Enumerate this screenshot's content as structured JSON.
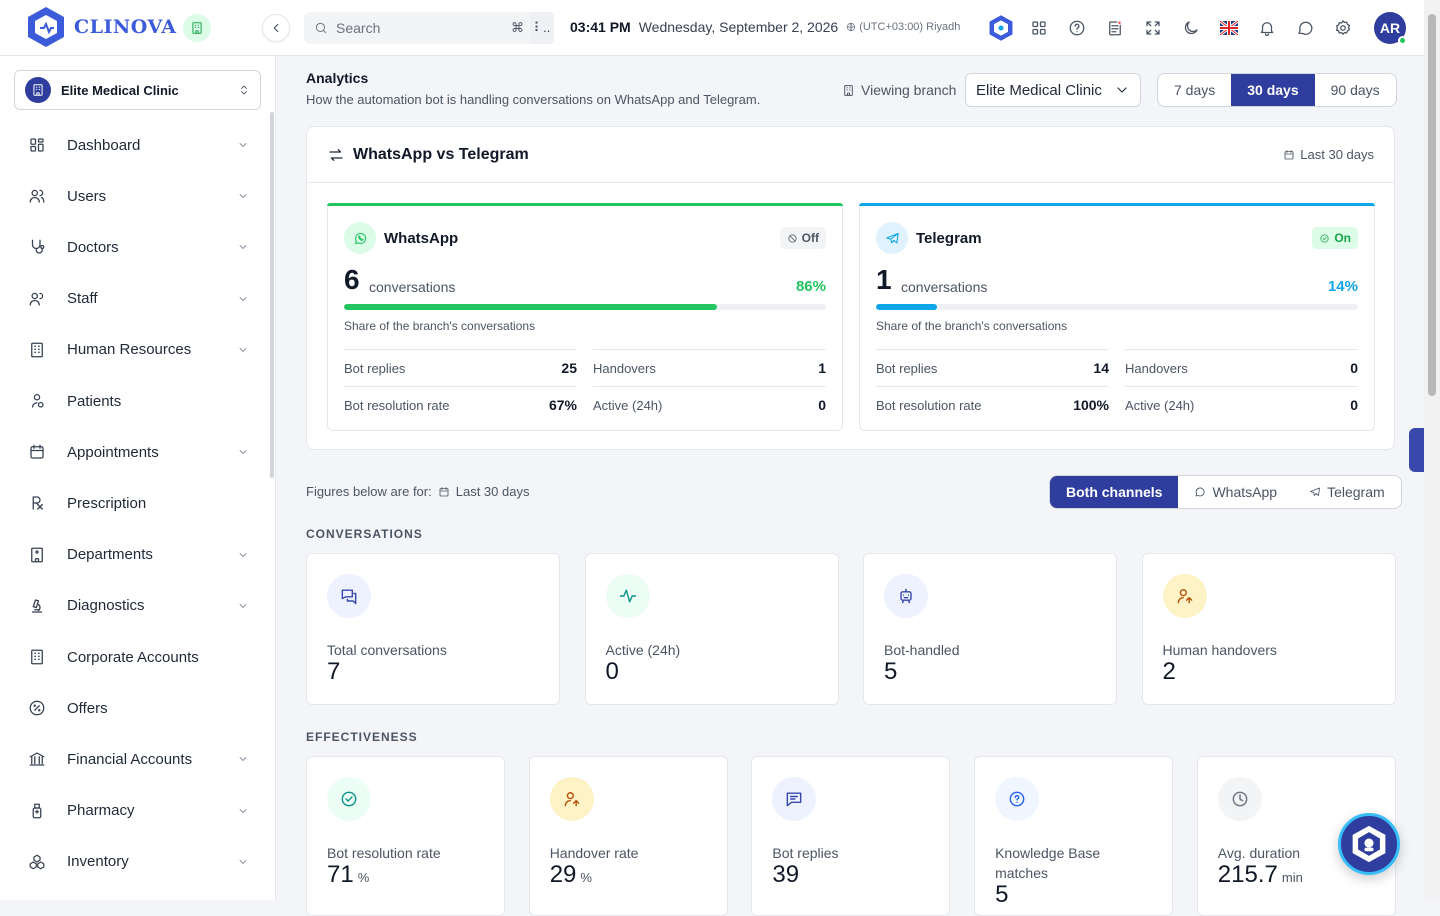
{
  "app": {
    "name": "CLINOVA"
  },
  "header": {
    "search_placeholder": "Search",
    "search_shortcut": "⌘",
    "search_more": "⠇..",
    "time": "03:41 PM",
    "date": "Wednesday, September 2, 2026",
    "timezone": "(UTC+03:00) Riyadh",
    "avatar_initials": "AR",
    "icons": [
      "apps-icon",
      "help-icon",
      "notes-icon",
      "fullscreen-icon",
      "dark-mode-icon",
      "language-flag-icon",
      "bell-icon",
      "chat-icon",
      "settings-icon"
    ]
  },
  "sidebar": {
    "branch": "Elite Medical Clinic",
    "items": [
      {
        "label": "Dashboard",
        "icon": "dashboard-icon",
        "chevron": true
      },
      {
        "label": "Users",
        "icon": "users-icon",
        "chevron": true
      },
      {
        "label": "Doctors",
        "icon": "stethoscope-icon",
        "chevron": true
      },
      {
        "label": "Staff",
        "icon": "staff-icon",
        "chevron": true
      },
      {
        "label": "Human Resources",
        "icon": "building-icon",
        "chevron": true
      },
      {
        "label": "Patients",
        "icon": "patient-icon",
        "chevron": false
      },
      {
        "label": "Appointments",
        "icon": "calendar-icon",
        "chevron": true
      },
      {
        "label": "Prescription",
        "icon": "prescription-icon",
        "chevron": false
      },
      {
        "label": "Departments",
        "icon": "hospital-icon",
        "chevron": true
      },
      {
        "label": "Diagnostics",
        "icon": "microscope-icon",
        "chevron": true
      },
      {
        "label": "Corporate Accounts",
        "icon": "office-icon",
        "chevron": false
      },
      {
        "label": "Offers",
        "icon": "discount-icon",
        "chevron": false
      },
      {
        "label": "Financial Accounts",
        "icon": "bank-icon",
        "chevron": true
      },
      {
        "label": "Pharmacy",
        "icon": "bottle-icon",
        "chevron": true
      },
      {
        "label": "Inventory",
        "icon": "boxes-icon",
        "chevron": true
      }
    ]
  },
  "analytics": {
    "title": "Analytics",
    "subtitle": "How the automation bot is handling conversations on WhatsApp and Telegram.",
    "viewing_branch_label": "Viewing branch",
    "branch_value": "Elite Medical Clinic",
    "ranges": [
      "7 days",
      "30 days",
      "90 days"
    ],
    "active_range": "30 days"
  },
  "comparison": {
    "title": "WhatsApp vs Telegram",
    "period": "Last 30 days",
    "channels": [
      {
        "name": "WhatsApp",
        "status": "Off",
        "count": "6",
        "unit": "conversations",
        "share_pct": "86%",
        "share_value": 0.86,
        "share_label": "Share of the branch's conversations",
        "color": "#22c55e",
        "stats": [
          {
            "label": "Bot replies",
            "value": "25"
          },
          {
            "label": "Handovers",
            "value": "1"
          },
          {
            "label": "Bot resolution rate",
            "value": "67%"
          },
          {
            "label": "Active (24h)",
            "value": "0"
          }
        ]
      },
      {
        "name": "Telegram",
        "status": "On",
        "count": "1",
        "unit": "conversations",
        "share_pct": "14%",
        "share_value": 0.14,
        "share_label": "Share of the branch's conversations",
        "color": "#0ea5e9",
        "stats": [
          {
            "label": "Bot replies",
            "value": "14"
          },
          {
            "label": "Handovers",
            "value": "0"
          },
          {
            "label": "Bot resolution rate",
            "value": "100%"
          },
          {
            "label": "Active (24h)",
            "value": "0"
          }
        ]
      }
    ]
  },
  "filters": {
    "figures_label": "Figures below are for:",
    "figures_period": "Last 30 days",
    "channel_tabs": [
      "Both channels",
      "WhatsApp",
      "Telegram"
    ],
    "active_tab": "Both channels"
  },
  "conversations": {
    "section_title": "CONVERSATIONS",
    "cards": [
      {
        "label": "Total conversations",
        "value": "7"
      },
      {
        "label": "Active (24h)",
        "value": "0"
      },
      {
        "label": "Bot-handled",
        "value": "5"
      },
      {
        "label": "Human handovers",
        "value": "2"
      }
    ]
  },
  "effectiveness": {
    "section_title": "EFFECTIVENESS",
    "cards": [
      {
        "label": "Bot resolution rate",
        "value": "71",
        "unit": "%"
      },
      {
        "label": "Handover rate",
        "value": "29",
        "unit": "%"
      },
      {
        "label": "Bot replies",
        "value": "39",
        "unit": ""
      },
      {
        "label": "Knowledge Base matches",
        "value": "5",
        "unit": ""
      },
      {
        "label": "Avg. duration",
        "value": "215.7",
        "unit": "min"
      }
    ]
  }
}
